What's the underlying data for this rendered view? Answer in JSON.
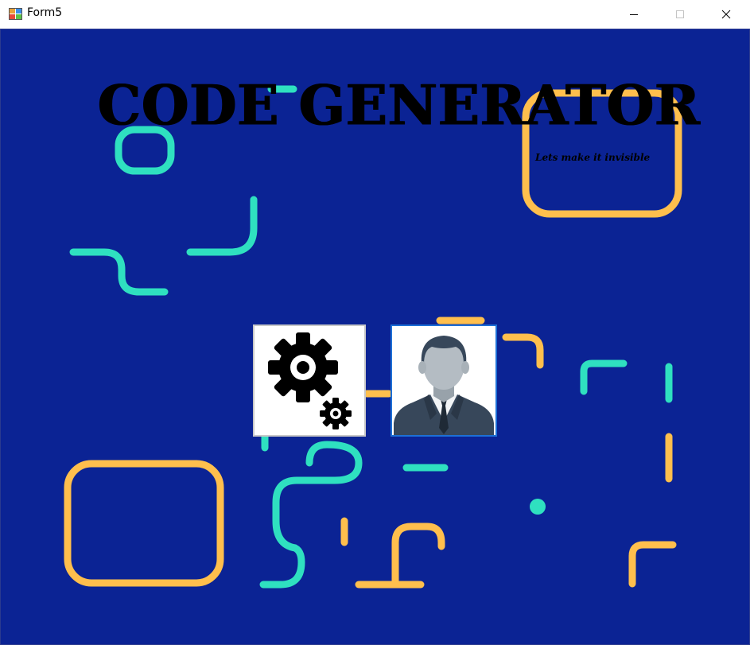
{
  "window": {
    "title": "Form5",
    "app_icon": "winforms-app-icon",
    "controls": [
      "minimize-icon",
      "maximize-icon",
      "close-icon"
    ]
  },
  "form": {
    "heading": "CODE GENERATOR",
    "subtitle": "Lets make it invisible",
    "background_color": "#0b2394",
    "decor_colors": {
      "teal": "#2fe0c0",
      "orange": "#ffbf4d"
    }
  },
  "buttons": [
    {
      "icon": "settings-gears-icon"
    },
    {
      "icon": "user-profile-icon"
    }
  ]
}
